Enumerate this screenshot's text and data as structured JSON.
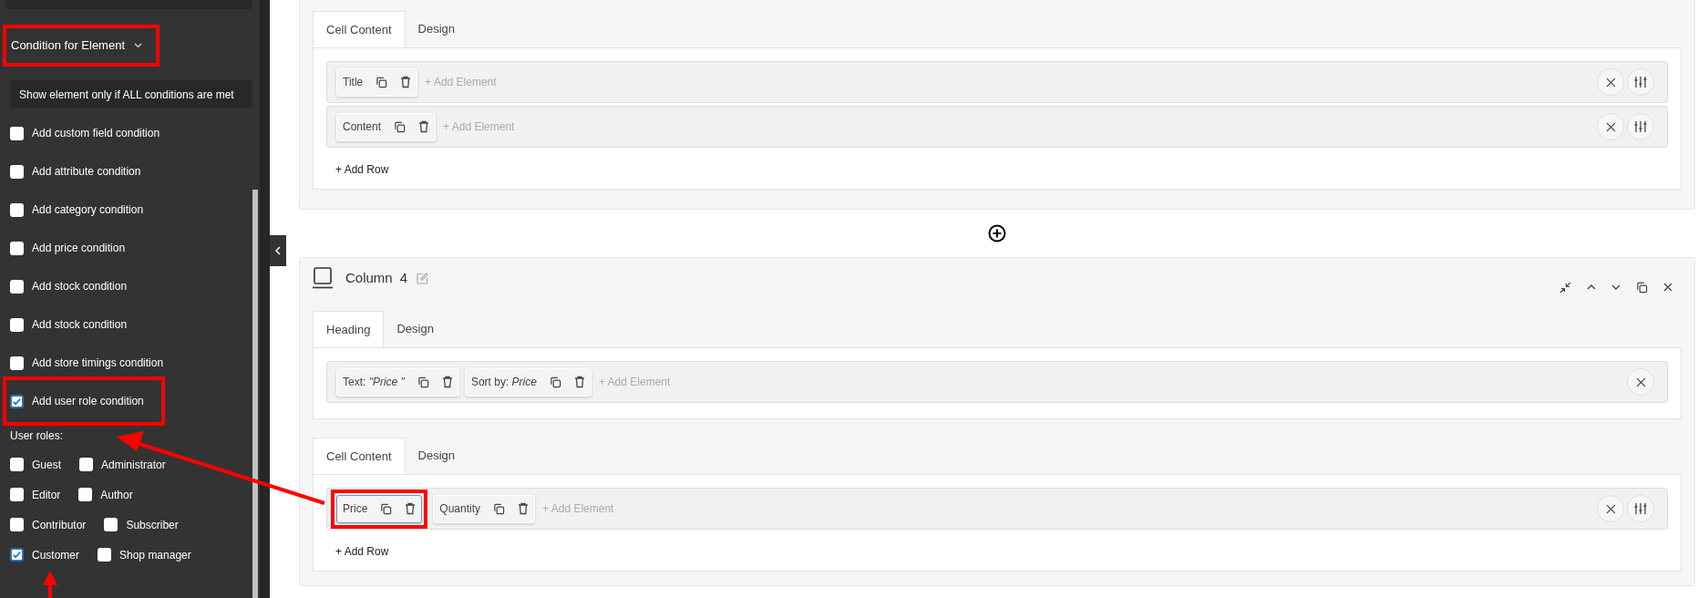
{
  "sidebar": {
    "header": {
      "label": "Condition for Element",
      "expanded": true,
      "annotated": true
    },
    "hint": "Show element only if ALL conditions are met",
    "conditions": [
      {
        "label": "Add custom field condition",
        "checked": false,
        "annotated": false
      },
      {
        "label": "Add attribute condition",
        "checked": false,
        "annotated": false
      },
      {
        "label": "Add category condition",
        "checked": false,
        "annotated": false
      },
      {
        "label": "Add price condition",
        "checked": false,
        "annotated": false
      },
      {
        "label": "Add stock condition",
        "checked": false,
        "annotated": false
      },
      {
        "label": "Add stock condition",
        "checked": false,
        "annotated": false
      },
      {
        "label": "Add store timings condition",
        "checked": false,
        "annotated": false
      },
      {
        "label": "Add user role condition",
        "checked": true,
        "annotated": true
      }
    ],
    "roles_label": "User roles:",
    "role_rows": [
      [
        {
          "label": "Guest",
          "checked": false
        },
        {
          "label": "Administrator",
          "checked": false
        }
      ],
      [
        {
          "label": "Editor",
          "checked": false
        },
        {
          "label": "Author",
          "checked": false
        }
      ],
      [
        {
          "label": "Contributor",
          "checked": false
        },
        {
          "label": "Subscriber",
          "checked": false
        }
      ],
      [
        {
          "label": "Customer",
          "checked": true
        },
        {
          "label": "Shop manager",
          "checked": false
        }
      ]
    ]
  },
  "top_card": {
    "tabs": [
      {
        "label": "Cell Content",
        "selected": true
      },
      {
        "label": "Design",
        "selected": false
      }
    ],
    "rows": [
      {
        "elements": [
          {
            "label": "Title",
            "selected": false,
            "annotated": false
          }
        ],
        "add_element": "+ Add Element",
        "settings": true
      },
      {
        "elements": [
          {
            "label": "Content",
            "selected": false,
            "annotated": false
          }
        ],
        "add_element": "+ Add Element",
        "settings": true
      }
    ],
    "add_row": "+ Add Row"
  },
  "column_card": {
    "title": "Column",
    "number": "4",
    "groups": [
      {
        "tabs": [
          {
            "label": "Heading",
            "selected": true
          },
          {
            "label": "Design",
            "selected": false
          }
        ],
        "rows": [
          {
            "elements": [
              {
                "label": "Text: *\"Price \"*",
                "selected": false,
                "annotated": false
              },
              {
                "label": "Sort by: *Price*",
                "selected": false,
                "annotated": false
              }
            ],
            "add_element": "+ Add Element",
            "settings": false
          }
        ]
      },
      {
        "tabs": [
          {
            "label": "Cell Content",
            "selected": true
          },
          {
            "label": "Design",
            "selected": false
          }
        ],
        "rows": [
          {
            "elements": [
              {
                "label": "Price",
                "selected": true,
                "annotated": true
              },
              {
                "label": "Quantity",
                "selected": false,
                "annotated": false
              }
            ],
            "add_element": "+ Add Element",
            "settings": true
          }
        ],
        "add_row": "+ Add Row"
      }
    ]
  }
}
